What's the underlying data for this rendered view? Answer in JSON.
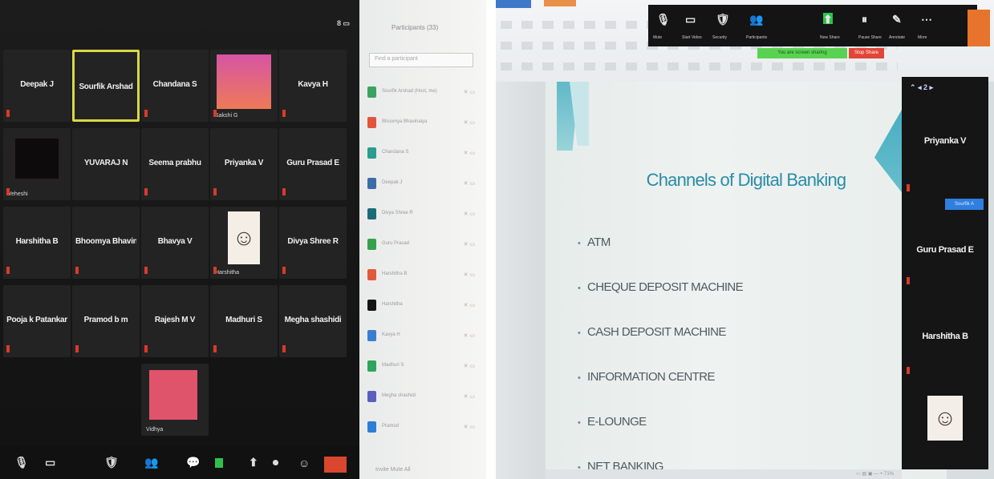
{
  "left_photo": {
    "gallery": {
      "top_icon": "8 ▭",
      "tiles": [
        {
          "name": "Deepak J",
          "type": "name",
          "muted": true
        },
        {
          "name": "Sourfik Arshad",
          "type": "name",
          "active": true,
          "muted": false
        },
        {
          "name": "Chandana S",
          "type": "name",
          "muted": true
        },
        {
          "name": "",
          "type": "pink",
          "small_name": "Sakshi G",
          "muted": true
        },
        {
          "name": "Kavya H",
          "type": "name",
          "muted": true
        },
        {
          "name": "",
          "type": "dark",
          "small_name": "Yeheshi",
          "muted": true
        },
        {
          "name": "YUVARAJ N",
          "type": "name",
          "muted": false
        },
        {
          "name": "Seema prabhu",
          "type": "name",
          "muted": true
        },
        {
          "name": "Priyanka V",
          "type": "name",
          "muted": true
        },
        {
          "name": "Guru Prasad E",
          "type": "name",
          "muted": true
        },
        {
          "name": "Harshitha B",
          "type": "name",
          "muted": true
        },
        {
          "name": "Bhoomya Bhavinaiya",
          "type": "name",
          "muted": true
        },
        {
          "name": "Bhavya V",
          "type": "name",
          "muted": true
        },
        {
          "name": "",
          "type": "avatar",
          "small_name": "Harshitha",
          "muted": true
        },
        {
          "name": "Divya Shree R",
          "type": "name",
          "muted": true
        },
        {
          "name": "Pooja k Patankar",
          "type": "name",
          "muted": true
        },
        {
          "name": "Pramod b m",
          "type": "name",
          "muted": true
        },
        {
          "name": "Rajesh M V",
          "type": "name",
          "muted": true
        },
        {
          "name": "Madhuri S",
          "type": "name",
          "muted": true
        },
        {
          "name": "Megha shashidi",
          "type": "name",
          "muted": true
        },
        {
          "name": "",
          "type": "red",
          "small_name": "Vidhya",
          "muted": false
        }
      ],
      "toolbar": [
        "🎙",
        "▭",
        "🛡",
        "👥",
        "💬",
        "⬆",
        "⏺",
        "☺"
      ]
    },
    "participants": {
      "title": "Participants (33)",
      "search_placeholder": "Find a participant",
      "rows": [
        {
          "name": "Sourfik Arshad (Host, me)",
          "color": "#3aa35f"
        },
        {
          "name": "Bhoomya Bhavinaiya",
          "color": "#e2553b"
        },
        {
          "name": "Chandana S",
          "color": "#2a9d8f"
        },
        {
          "name": "Deepak J",
          "color": "#3b6ea8"
        },
        {
          "name": "Divya Shree R",
          "color": "#1b6b78"
        },
        {
          "name": "Guru Prasad",
          "color": "#37a04c"
        },
        {
          "name": "Harshitha B",
          "color": "#e1593b"
        },
        {
          "name": "Harshitha",
          "color": "#151515"
        },
        {
          "name": "Kavya H",
          "color": "#3a7ed0"
        },
        {
          "name": "Madhuri S",
          "color": "#2fa55c"
        },
        {
          "name": "Megha shashidi",
          "color": "#5a5fbf"
        },
        {
          "name": "Pramod",
          "color": "#2b7fd6"
        }
      ],
      "footer": "Invite   Mute All"
    }
  },
  "right_photo": {
    "share_toolbar": {
      "items": [
        {
          "icon": "🎙",
          "label": "Mute"
        },
        {
          "icon": "▭",
          "label": "Start Video"
        },
        {
          "icon": "🛡",
          "label": "Security"
        },
        {
          "icon": "👥",
          "label": "Participants"
        },
        {
          "icon": "⬆",
          "label": "New Share"
        },
        {
          "icon": "⏸",
          "label": "Pause Share"
        },
        {
          "icon": "✎",
          "label": "Annotate"
        },
        {
          "icon": "⋯",
          "label": "More"
        }
      ],
      "status_text": "You are screen sharing",
      "stop_label": "Stop Share"
    },
    "slide": {
      "title": "Channels of Digital Banking",
      "bullets": [
        "ATM",
        "CHEQUE DEPOSIT MACHINE",
        "CASH DEPOSIT MACHINE",
        "INFORMATION CENTRE",
        "E-LOUNGE",
        "NET BANKING"
      ]
    },
    "gallery_strip": {
      "top": "⌃ ◂ 2 ▸",
      "names": [
        "Priyanka V",
        "Guru Prasad E",
        "Harshitha B"
      ],
      "pill": "Sourfik A"
    },
    "status_bar": "▭  ▤  ▣  —  +  71%"
  }
}
